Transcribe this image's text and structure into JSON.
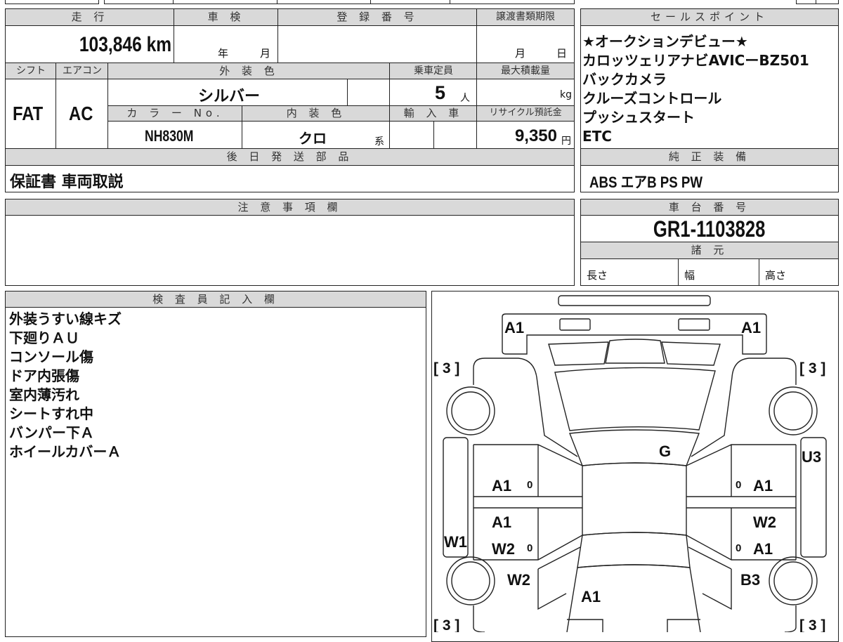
{
  "vehicle_info": {
    "mileage_label": "走 行",
    "mileage_value": "103,846 km",
    "inspection_label": "車 検",
    "inspection_year": "年",
    "inspection_month": "月",
    "registration_label": "登 録 番 号",
    "registration_value": "",
    "transfer_deadline_label": "譲渡書類期限",
    "transfer_month": "月",
    "transfer_day": "日",
    "shift_label": "シフト",
    "shift_value": "FAT",
    "aircon_label": "エアコン",
    "aircon_value": "AC",
    "exterior_color_label": "外 装 色",
    "exterior_color_value": "シルバー",
    "capacity_label": "乗車定員",
    "capacity_value": "5",
    "capacity_unit": "人",
    "max_load_label": "最大積載量",
    "max_load_unit": "kg",
    "color_no_label": "カ ラ ー No.",
    "color_no_value": "NH830M",
    "interior_color_label": "内 装 色",
    "interior_color_value": "クロ",
    "interior_color_suffix": "系",
    "import_label": "輸 入 車",
    "recycle_label": "リサイクル預託金",
    "recycle_value": "9,350",
    "recycle_unit": "円",
    "later_parts_label": "後 日 発 送 部 品",
    "later_parts_value": "保証書 車両取説"
  },
  "sales_points": {
    "label": "セールスポイント",
    "items": [
      "★オークションデビュー★",
      "カロッツェリアナビAVICーBZ501",
      "バックカメラ",
      "クルーズコントロール",
      "プッシュスタート",
      "ETC"
    ]
  },
  "standard_equipment": {
    "label": "純 正 装 備",
    "value": "ABS エアB PS PW"
  },
  "notes": {
    "label": "注 意 事 項 欄",
    "value": ""
  },
  "chassis": {
    "label": "車 台 番 号",
    "value": "GR1-1103828",
    "specs_label": "諸 元",
    "length_label": "長さ",
    "width_label": "幅",
    "height_label": "高さ"
  },
  "inspector": {
    "label": "検 査 員 記 入 欄",
    "items": [
      "外装うすい線キズ",
      "下廻りＡＵ",
      "コンソール傷",
      "ドア内張傷",
      "室内薄汚れ",
      "シートすれ中",
      "バンパー下Ａ",
      "ホイールカバーＡ"
    ]
  },
  "diagram": {
    "marks": {
      "front_left": "A1",
      "front_right": "A1",
      "tire_fl": "[ 3 ]",
      "tire_fr": "[ 3 ]",
      "tire_rl": "[ 3 ]",
      "tire_rr": "[ 3 ]",
      "windshield": "G",
      "right_rocker": "U3",
      "left_front_door": "A1",
      "left_front_door_zero": "0",
      "right_front_door": "A1",
      "right_front_door_zero": "0",
      "left_rear_door_1": "A1",
      "left_rear_door_2": "W2",
      "left_rear_door_zero": "0",
      "right_rear_door_1": "W2",
      "right_rear_door_2": "A1",
      "right_rear_door_zero": "0",
      "left_rocker": "W1",
      "left_quarter": "W2",
      "right_quarter": "B3",
      "trunk": "A1"
    }
  }
}
